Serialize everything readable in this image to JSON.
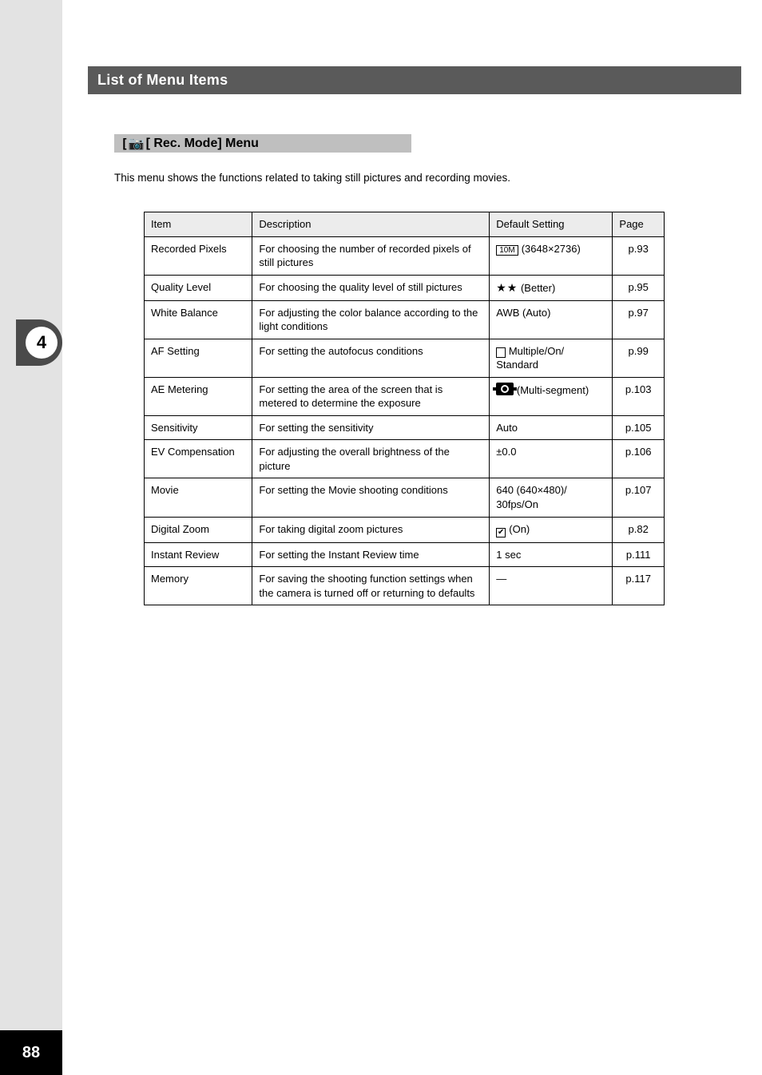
{
  "pageNumber": "88",
  "sideTab": "4",
  "header": "List of Menu Items",
  "subheader": "[ Rec. Mode] Menu",
  "description": "This menu shows the functions related to taking still pictures and recording movies.",
  "table": {
    "headers": [
      "Item",
      "Description",
      "Default Setting",
      "Page"
    ],
    "rows": [
      {
        "item": "Recorded Pixels",
        "desc": "For choosing the number of recorded pixels of still pictures",
        "default": "10M (3648×2736)",
        "page": "p.93"
      },
      {
        "item": "Quality Level",
        "desc": "For choosing the quality level of still pictures",
        "default": {
          "prefix": "",
          "stars": "★★",
          "suffix": " (Better)"
        },
        "page": "p.95"
      },
      {
        "item": "White Balance",
        "desc": "For adjusting the color balance according to the light conditions",
        "default": "AWB (Auto)",
        "page": "p.97"
      },
      {
        "item": "AF Setting",
        "desc": "For setting the autofocus conditions",
        "default": "Multiple/On/ Standard",
        "page": "p.99"
      },
      {
        "item": "AE Metering",
        "desc": "For setting the area of the screen that is metered to determine the exposure",
        "default": {
          "iconLabel": " (Multi-segment)"
        },
        "page": "p.103"
      },
      {
        "item": "Sensitivity",
        "desc": "For setting the sensitivity",
        "default": "Auto",
        "page": "p.105"
      },
      {
        "item": "EV Compensation",
        "desc": "For adjusting the overall brightness of the picture",
        "default": "±0.0",
        "page": "p.106"
      },
      {
        "item": "Movie",
        "desc": "For setting the Movie shooting conditions",
        "default": "640 (640×480)/ 30fps/On",
        "page": "p.107"
      },
      {
        "item": "Digital Zoom",
        "desc": "For taking digital zoom pictures",
        "default": "O (On)",
        "page": "p.82"
      },
      {
        "item": "Instant Review",
        "desc": "For setting the Instant Review time",
        "default": "1 sec",
        "page": "p.111"
      },
      {
        "item": "Memory",
        "desc": "For saving the shooting function settings when the camera is turned off or returning to defaults",
        "default": "—",
        "page": "p.117"
      }
    ]
  }
}
